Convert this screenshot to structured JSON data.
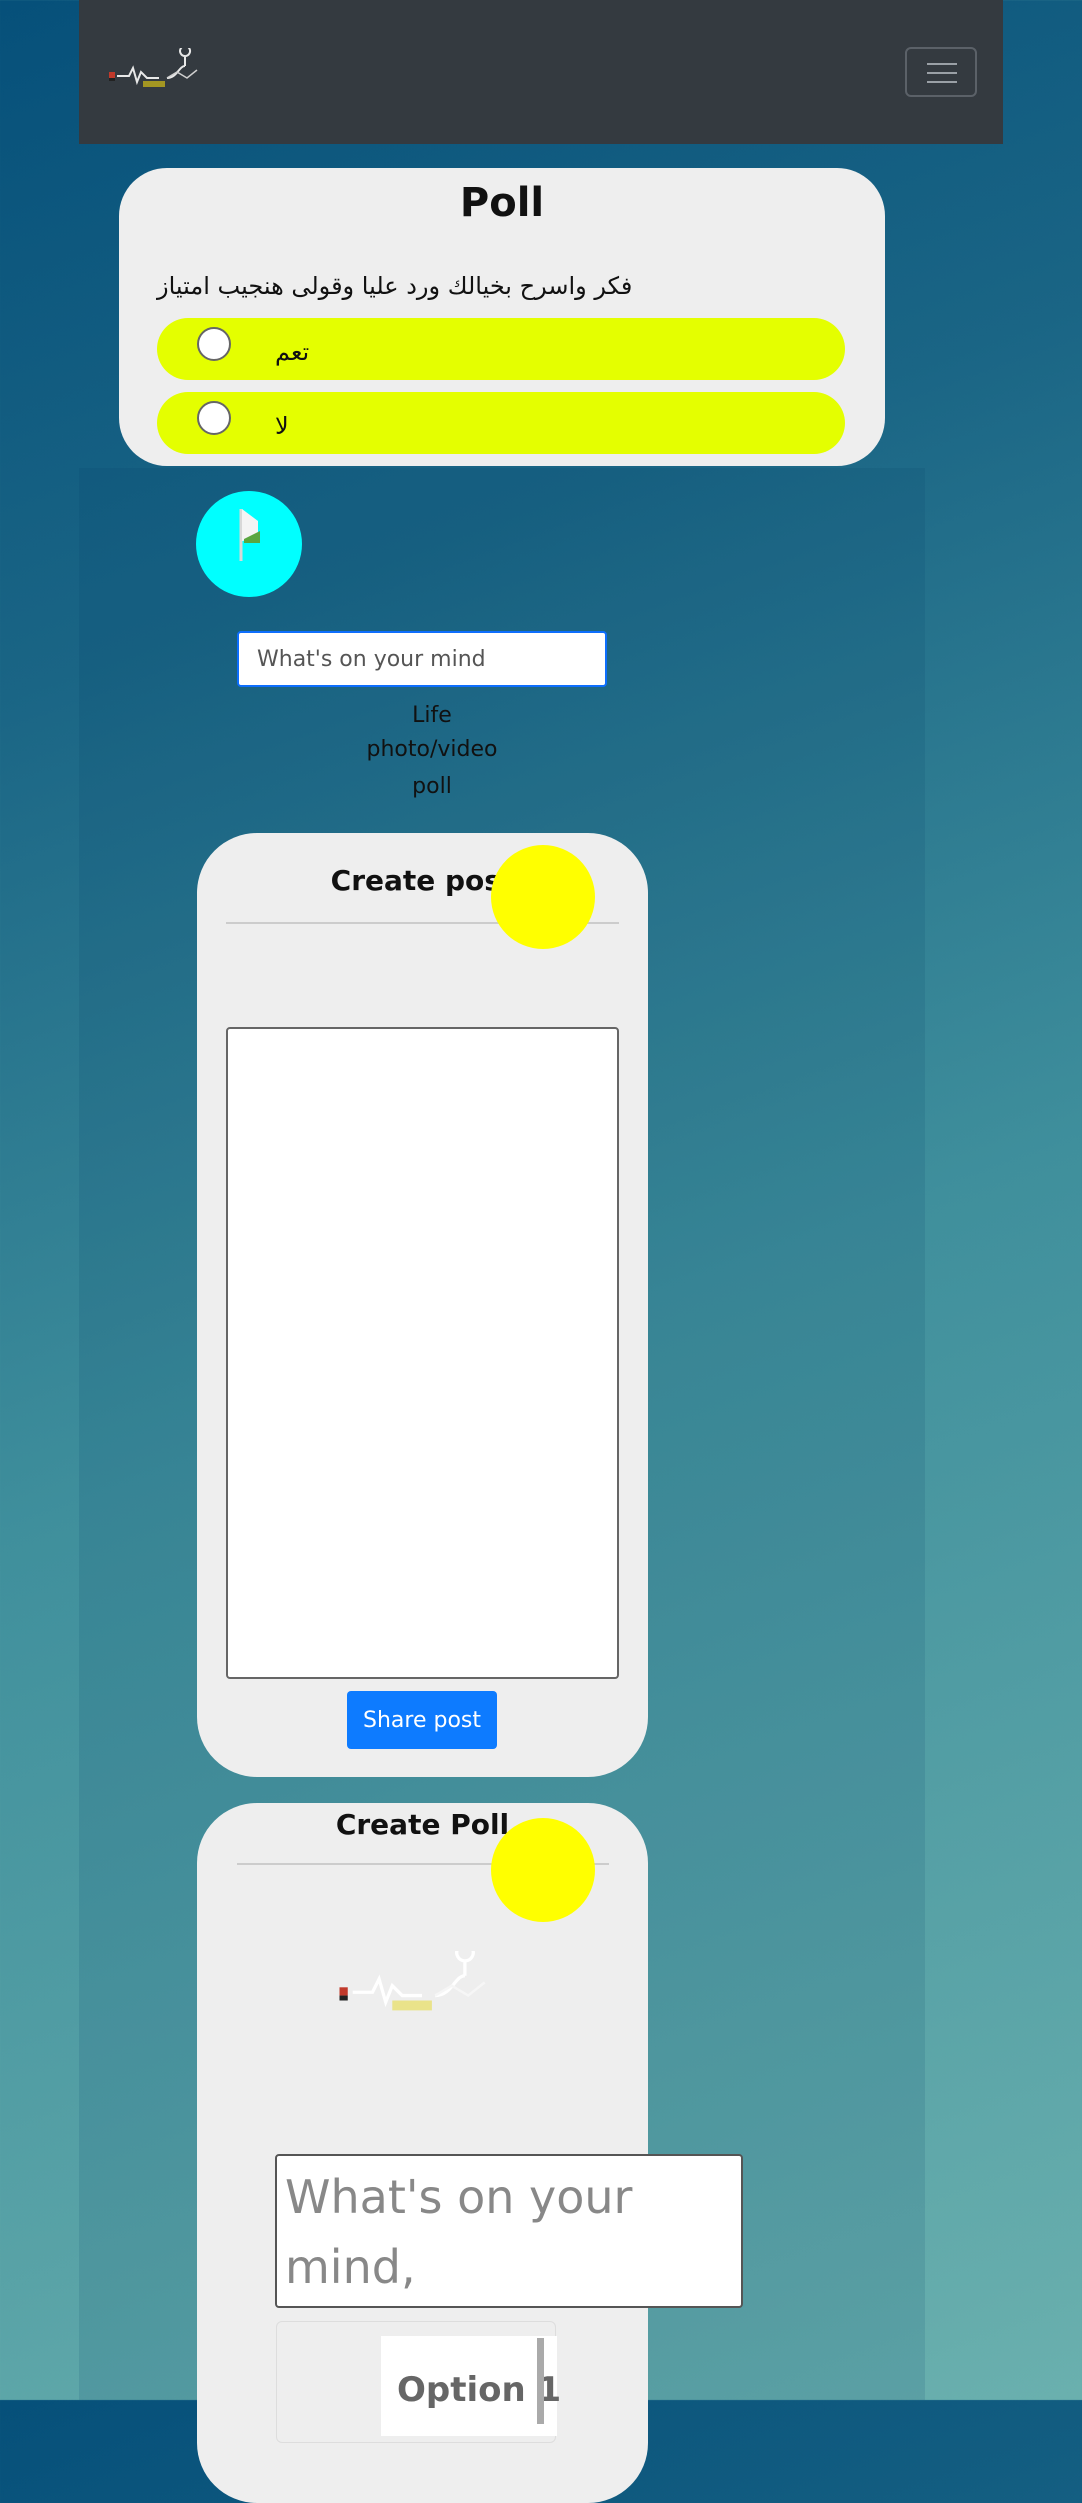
{
  "navbar": {
    "menu_icon": "hamburger-menu-icon",
    "logo_icon": "egypt-healthcare-logo"
  },
  "poll": {
    "title": "Poll",
    "question": "فكر واسرح بخيالك ورد عليا وقولى هنجيب امتياز",
    "options": [
      {
        "label": "تعم"
      },
      {
        "label": "لا"
      }
    ],
    "option_color": "#e4ff00"
  },
  "composer": {
    "avatar_color": "#00ffff",
    "input_placeholder": "What's on your mind",
    "links": [
      "Life",
      "photo/video",
      "poll"
    ]
  },
  "create_post": {
    "title": "Create post",
    "share_label": "Share post",
    "share_color": "#0d7bff"
  },
  "create_poll": {
    "title": "Create Poll",
    "input_placeholder": "What's on your mind, EgyptHealthCare?",
    "option_placeholder": "Option 1"
  },
  "accent_yellow": "#ffff00"
}
